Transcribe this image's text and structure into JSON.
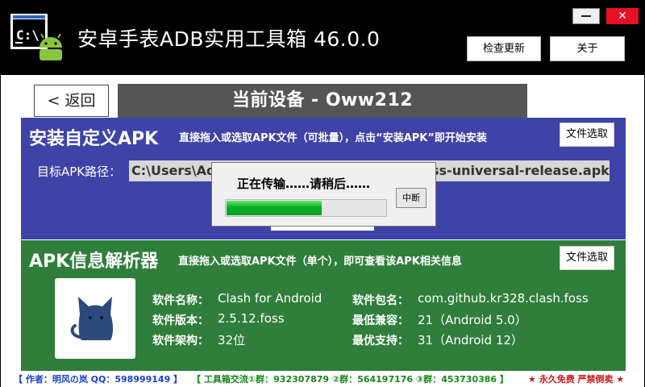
{
  "window": {
    "title": "安卓手表ADB实用工具箱  46.0.0",
    "minimize_label": "",
    "close_label": "✕"
  },
  "top_buttons": {
    "check_update": "检查更新",
    "about": "关于"
  },
  "nav": {
    "back_label": "< 返回",
    "device_label": "当前设备 - Oww212"
  },
  "install": {
    "title": "安装自定义APK",
    "description": "直接拖入或选取APK文件（可批量），点击“安装APK”即开始安装",
    "file_button": "文件选取",
    "target_label": "目标APK路径：",
    "target_path": "C:\\Users\\Ad",
    "target_path_tail": "ss-universal-release.apk"
  },
  "progress": {
    "message": "正在传输……请稍后……",
    "value": 0.6,
    "abort_label": "中断"
  },
  "apk_info": {
    "title": "APK信息解析器",
    "description": "直接拖入或选取APK文件（单个），即可查看该APK相关信息",
    "file_button": "文件选取",
    "fields": {
      "name_label": "软件名称：",
      "name_value": "Clash for Android",
      "version_label": "软件版本：",
      "version_value": "2.5.12.foss",
      "arch_label": "软件架构：",
      "arch_value": "32位",
      "package_label": "软件包名：",
      "package_value": "com.github.kr328.clash.foss",
      "min_label": "最低兼容：",
      "min_value": "21（Android 5.0）",
      "target_label": "最优支持：",
      "target_value": "31（Android 12）"
    },
    "icon": "cat-icon",
    "icon_color": "#2d4a7c"
  },
  "footer": {
    "author": "【 作者：明风の岚  QQ：598999149 】",
    "groups": "【 工具箱交流①群：932307879  ②群：564197176  ③群：453730386 】",
    "free": "★ 永久免费 严禁倒卖 ★"
  },
  "colors": {
    "install_panel": "#3f43a7",
    "apk_panel": "#2f7e3b",
    "titlebar": "#000000",
    "device_bar": "#555555",
    "progress_fill": "#06b025",
    "close_button": "#e81123"
  }
}
